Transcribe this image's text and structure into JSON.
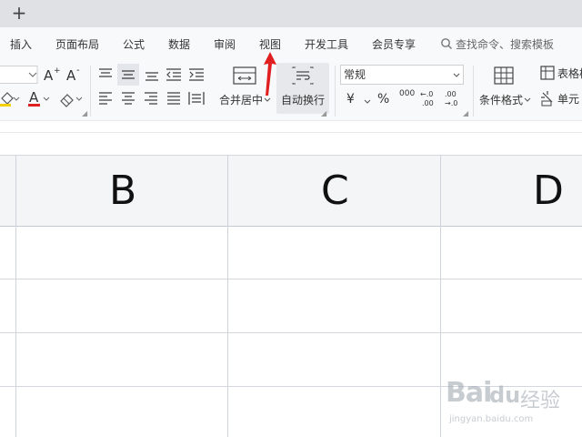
{
  "tabstrip": {
    "new_tab_symbol": "+"
  },
  "menu": {
    "items": [
      "插入",
      "页面布局",
      "公式",
      "数据",
      "审阅",
      "视图",
      "开发工具",
      "会员专享"
    ],
    "search_placeholder": "查找命令、搜索模板"
  },
  "ribbon": {
    "merge_center": "合并居中",
    "wrap_text": "自动换行",
    "number_format": "常规",
    "conditional_format": "条件格式",
    "table_style": "表格样",
    "cell_style": "单元",
    "currency_symbol": "¥",
    "percent_symbol": "%",
    "thousands_symbol": "000",
    "font_color_letter": "A"
  },
  "sheet": {
    "columns": [
      "B",
      "C",
      "D"
    ]
  },
  "annotation": {
    "arrow_color": "#e02020"
  },
  "watermark": {
    "brand": "Bai",
    "paw": "du",
    "jingyan": "经验",
    "url": "jingyan.baidu.com"
  },
  "colors": {
    "accent_red": "#e02020",
    "header_bg": "#f4f5f7",
    "grid": "#d4d7dd"
  }
}
